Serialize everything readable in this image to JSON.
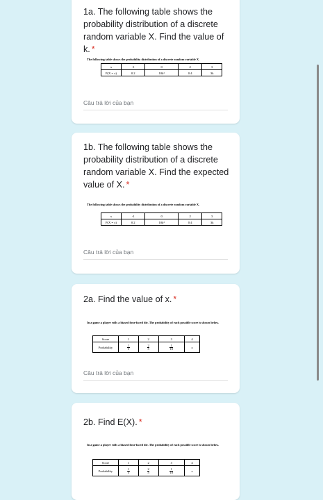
{
  "questions": [
    {
      "id": "1a",
      "title": "1a. The following table shows the probability distribution of a discrete random variable X. Find the value of k.",
      "required": "*",
      "caption": "The following table shows the probability distribution of a discrete random variable X.",
      "table": {
        "row1": [
          "x",
          "-1",
          "0",
          "2",
          "3"
        ],
        "row2": [
          "P(X = x)",
          "0.2",
          "10k²",
          "0.4",
          "3k"
        ]
      },
      "answer_placeholder": "Câu trả lời của bạn"
    },
    {
      "id": "1b",
      "title": "1b. The following table shows the probability distribution of a discrete random variable X. Find the expected value of X.",
      "required": "*",
      "caption": "The following table shows the probability distribution of a discrete random variable X.",
      "table": {
        "row1": [
          "x",
          "-1",
          "0",
          "2",
          "3"
        ],
        "row2": [
          "P(X = x)",
          "0.2",
          "10k²",
          "0.4",
          "3k"
        ]
      },
      "answer_placeholder": "Câu trả lời của bạn"
    },
    {
      "id": "2a",
      "title": "2a. Find the value of x.",
      "required": "*",
      "caption": "In a game a player rolls a biased four-faced die. The probability of each possible score is shown below.",
      "table": {
        "row1": [
          "Score",
          "1",
          "2",
          "3",
          "4"
        ],
        "row2_label": "Probability",
        "fractions": [
          [
            "1",
            "5"
          ],
          [
            "2",
            "5"
          ],
          [
            "1",
            "10"
          ]
        ],
        "last": "x"
      },
      "answer_placeholder": "Câu trả lời của bạn"
    },
    {
      "id": "2b",
      "title": "2b. Find E(X).",
      "required": "*",
      "caption": "In a game a player rolls a biased four-faced die. The probability of each possible score is shown below.",
      "table": {
        "row1": [
          "Score",
          "1",
          "2",
          "3",
          "4"
        ],
        "row2_label": "Probability",
        "fractions": [
          [
            "1",
            "5"
          ],
          [
            "2",
            "5"
          ],
          [
            "1",
            "10"
          ]
        ],
        "last": "x"
      }
    }
  ]
}
